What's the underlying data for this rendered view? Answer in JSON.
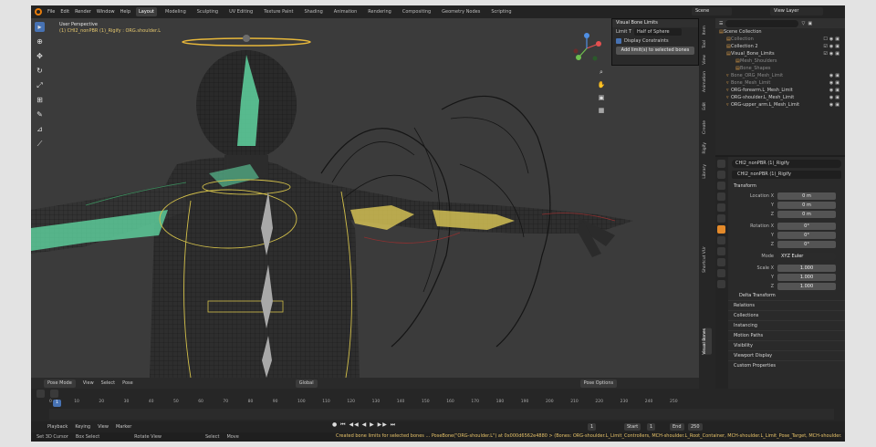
{
  "menu": [
    "File",
    "Edit",
    "Render",
    "Window",
    "Help"
  ],
  "workspaces": [
    {
      "label": "Layout",
      "active": true
    },
    {
      "label": "Modeling"
    },
    {
      "label": "Sculpting"
    },
    {
      "label": "UV Editing"
    },
    {
      "label": "Texture Paint"
    },
    {
      "label": "Shading"
    },
    {
      "label": "Animation"
    },
    {
      "label": "Rendering"
    },
    {
      "label": "Compositing"
    },
    {
      "label": "Geometry Nodes"
    },
    {
      "label": "Scripting"
    }
  ],
  "topright": {
    "scene": "Scene",
    "view_layer": "View Layer"
  },
  "viewport": {
    "title": "User Perspective",
    "subtitle": "(1) CHI2_nonPBR (1)_Rigify : ORG.shoulder.L",
    "header": {
      "mode": "Pose Mode",
      "view": "View",
      "select": "Select",
      "pose": "Pose",
      "orientation": "Global",
      "pose_options": "Pose Options"
    }
  },
  "bone_limits_panel": {
    "title": "Visual Bone Limits",
    "limit_label": "Limit T",
    "shape": "Half of Sphere",
    "display_constraints": "Display Constraints",
    "button": "Add limit(s) to selected bones"
  },
  "sidebar_tabs": [
    "Item",
    "Tool",
    "View",
    "Animation",
    "Edit",
    "Create",
    "Rigify",
    "Library",
    "Shortcut VUr",
    "Visual Bones"
  ],
  "outliner": {
    "rows": [
      {
        "label": "Scene Collection",
        "indent": 0
      },
      {
        "label": "Collection",
        "indent": 1,
        "dim": true
      },
      {
        "label": "Collection 2",
        "indent": 1
      },
      {
        "label": "Visual_Bone_Limits",
        "indent": 1
      },
      {
        "label": "Mesh_Shoulders",
        "indent": 2,
        "dim": true
      },
      {
        "label": "Bone_Shapes",
        "indent": 2,
        "dim": true
      },
      {
        "label": "Bone_ORG_Mesh_Limit",
        "indent": 1,
        "dim": true
      },
      {
        "label": "Bone_Mesh_Limit",
        "indent": 1,
        "dim": true
      },
      {
        "label": "ORG-forearm.L_Mesh_Limit",
        "indent": 1
      },
      {
        "label": "ORG-shoulder.L_Mesh_Limit",
        "indent": 1
      },
      {
        "label": "ORG-upper_arm.L_Mesh_Limit",
        "indent": 1
      }
    ]
  },
  "properties": {
    "object": "CHI2_nonPBR (1)_Rigify",
    "field_name": "CHI2_nonPBR (1)_Rigify",
    "transform_label": "Transform",
    "location": [
      {
        "label": "Location X",
        "value": "0 m"
      },
      {
        "label": "Y",
        "value": "0 m"
      },
      {
        "label": "Z",
        "value": "0 m"
      }
    ],
    "rotation": [
      {
        "label": "Rotation X",
        "value": "0°"
      },
      {
        "label": "Y",
        "value": "0°"
      },
      {
        "label": "Z",
        "value": "0°"
      }
    ],
    "mode_label": "Mode",
    "mode": "XYZ Euler",
    "scale": [
      {
        "label": "Scale X",
        "value": "1.000"
      },
      {
        "label": "Y",
        "value": "1.000"
      },
      {
        "label": "Z",
        "value": "1.000"
      }
    ],
    "delta": "Delta Transform",
    "sections": [
      "Relations",
      "Collections",
      "Instancing",
      "Motion Paths",
      "Visibility",
      "Viewport Display",
      "Custom Properties"
    ]
  },
  "timeline": {
    "ticks": [
      "0",
      "10",
      "20",
      "30",
      "40",
      "50",
      "60",
      "70",
      "80",
      "90",
      "100",
      "110",
      "120",
      "130",
      "140",
      "150",
      "160",
      "170",
      "180",
      "190",
      "200",
      "210",
      "220",
      "230",
      "240",
      "250"
    ],
    "current": "1",
    "footer": {
      "playback": "Playback",
      "keying": "Keying",
      "view": "View",
      "marker": "Marker",
      "start_label": "Start",
      "start": "1",
      "end_label": "End",
      "end": "250"
    }
  },
  "statusbar": {
    "left": [
      "Set 3D Cursor",
      "Box Select",
      "Rotate View",
      "Select",
      "Move"
    ],
    "report": "Created bone limits for selected bones ... PoseBone(\"ORG-shoulder.L\") at 0x000d6562e4880 > (Bones: ORG-shoulder.L_Limit_Controllers, MCH-shoulder.L_Root_Container, MCH-shoulder.L_Limit_Pose_Target, MCH-shoulder.L_Limit)"
  },
  "colors": {
    "accent": "#4772b3",
    "bone_green": "#5fd4a0",
    "bone_yellow": "#e8d35a",
    "wire": "#111111"
  }
}
